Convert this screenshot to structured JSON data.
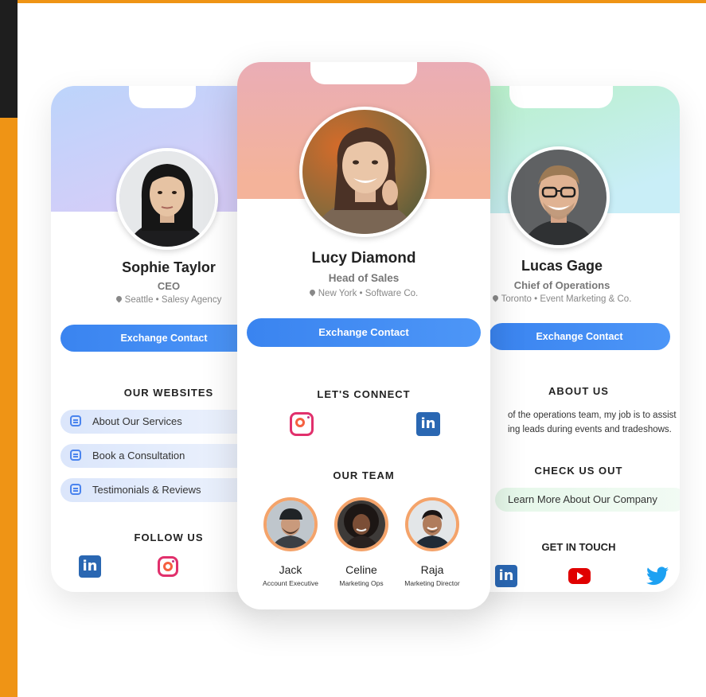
{
  "left_card": {
    "name": "Sophie Taylor",
    "role": "CEO",
    "location": "Seattle • Salesy Agency",
    "button_label": "Exchange Contact",
    "websites_heading": "OUR WEBSITES",
    "websites": [
      "About Our Services",
      "Book a Consultation",
      "Testimonials & Reviews"
    ],
    "follow_heading": "FOLLOW US"
  },
  "center_card": {
    "name": "Lucy Diamond",
    "role": "Head of Sales",
    "location": "New York • Software Co.",
    "button_label": "Exchange Contact",
    "connect_heading": "LET'S CONNECT",
    "team_heading": "OUR TEAM",
    "team": [
      {
        "name": "Jack",
        "role": "Account Executive"
      },
      {
        "name": "Celine",
        "role": "Marketing Ops"
      },
      {
        "name": "Raja",
        "role": "Marketing Director"
      }
    ]
  },
  "right_card": {
    "name": "Lucas Gage",
    "role": "Chief of Operations",
    "location": "Toronto • Event Marketing & Co.",
    "button_label": "Exchange Contact",
    "about_heading": "ABOUT US",
    "about_line1": "of the operations team, my job is to assist",
    "about_line2": "ing leads during events and tradeshows.",
    "check_heading": "CHECK US OUT",
    "link_label": "Learn More About Our Company",
    "touch_heading": "GET IN TOUCH"
  },
  "colors": {
    "accent_blue": "#3a84f0",
    "background_orange": "#ef9415",
    "linkedin": "#2a67b2",
    "youtube": "#e00000",
    "twitter": "#1da1f2"
  },
  "icons": [
    "linkedin-icon",
    "instagram-icon",
    "youtube-icon",
    "twitter-icon",
    "location-pin-icon",
    "document-icon"
  ]
}
